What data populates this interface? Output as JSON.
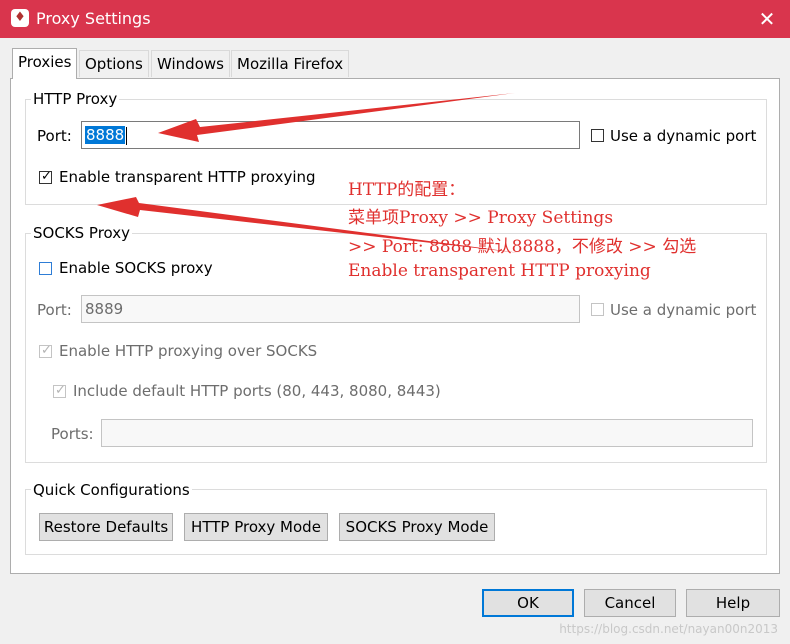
{
  "window": {
    "title": "Proxy Settings",
    "close_glyph": "✕",
    "app_icon": "charles-app-icon"
  },
  "tabs": [
    {
      "label": "Proxies",
      "active": true
    },
    {
      "label": "Options",
      "active": false
    },
    {
      "label": "Windows",
      "active": false
    },
    {
      "label": "Mozilla Firefox",
      "active": false
    }
  ],
  "http_proxy": {
    "group_label": "HTTP Proxy",
    "port_label": "Port:",
    "port_value": "8888",
    "dynamic_port_label": "Use a dynamic port",
    "dynamic_port_checked": false,
    "transparent_label": "Enable transparent HTTP proxying",
    "transparent_checked": true
  },
  "socks_proxy": {
    "group_label": "SOCKS Proxy",
    "enable_label": "Enable SOCKS proxy",
    "enable_checked": false,
    "port_label": "Port:",
    "port_value": "8889",
    "dynamic_port_label": "Use a dynamic port",
    "http_over_socks_label": "Enable HTTP proxying over SOCKS",
    "include_ports_label": "Include default HTTP ports (80, 443, 8080, 8443)",
    "ports_label": "Ports:",
    "ports_value": ""
  },
  "quick_config": {
    "group_label": "Quick Configurations",
    "buttons": [
      "Restore Defaults",
      "HTTP Proxy Mode",
      "SOCKS Proxy Mode"
    ]
  },
  "dialog_buttons": {
    "ok": "OK",
    "cancel": "Cancel",
    "help": "Help"
  },
  "annotation": {
    "lines": [
      "HTTP的配置：",
      "菜单项Proxy >> Proxy Settings",
      ">> Port: 8888 默认8888，不修改 >> 勾选",
      "Enable transparent HTTP proxying"
    ],
    "color": "#e0302e"
  },
  "watermark": "https://blog.csdn.net/nayan00n2013",
  "colors": {
    "titlebar": "#d9354d",
    "accent": "#0078d7"
  }
}
